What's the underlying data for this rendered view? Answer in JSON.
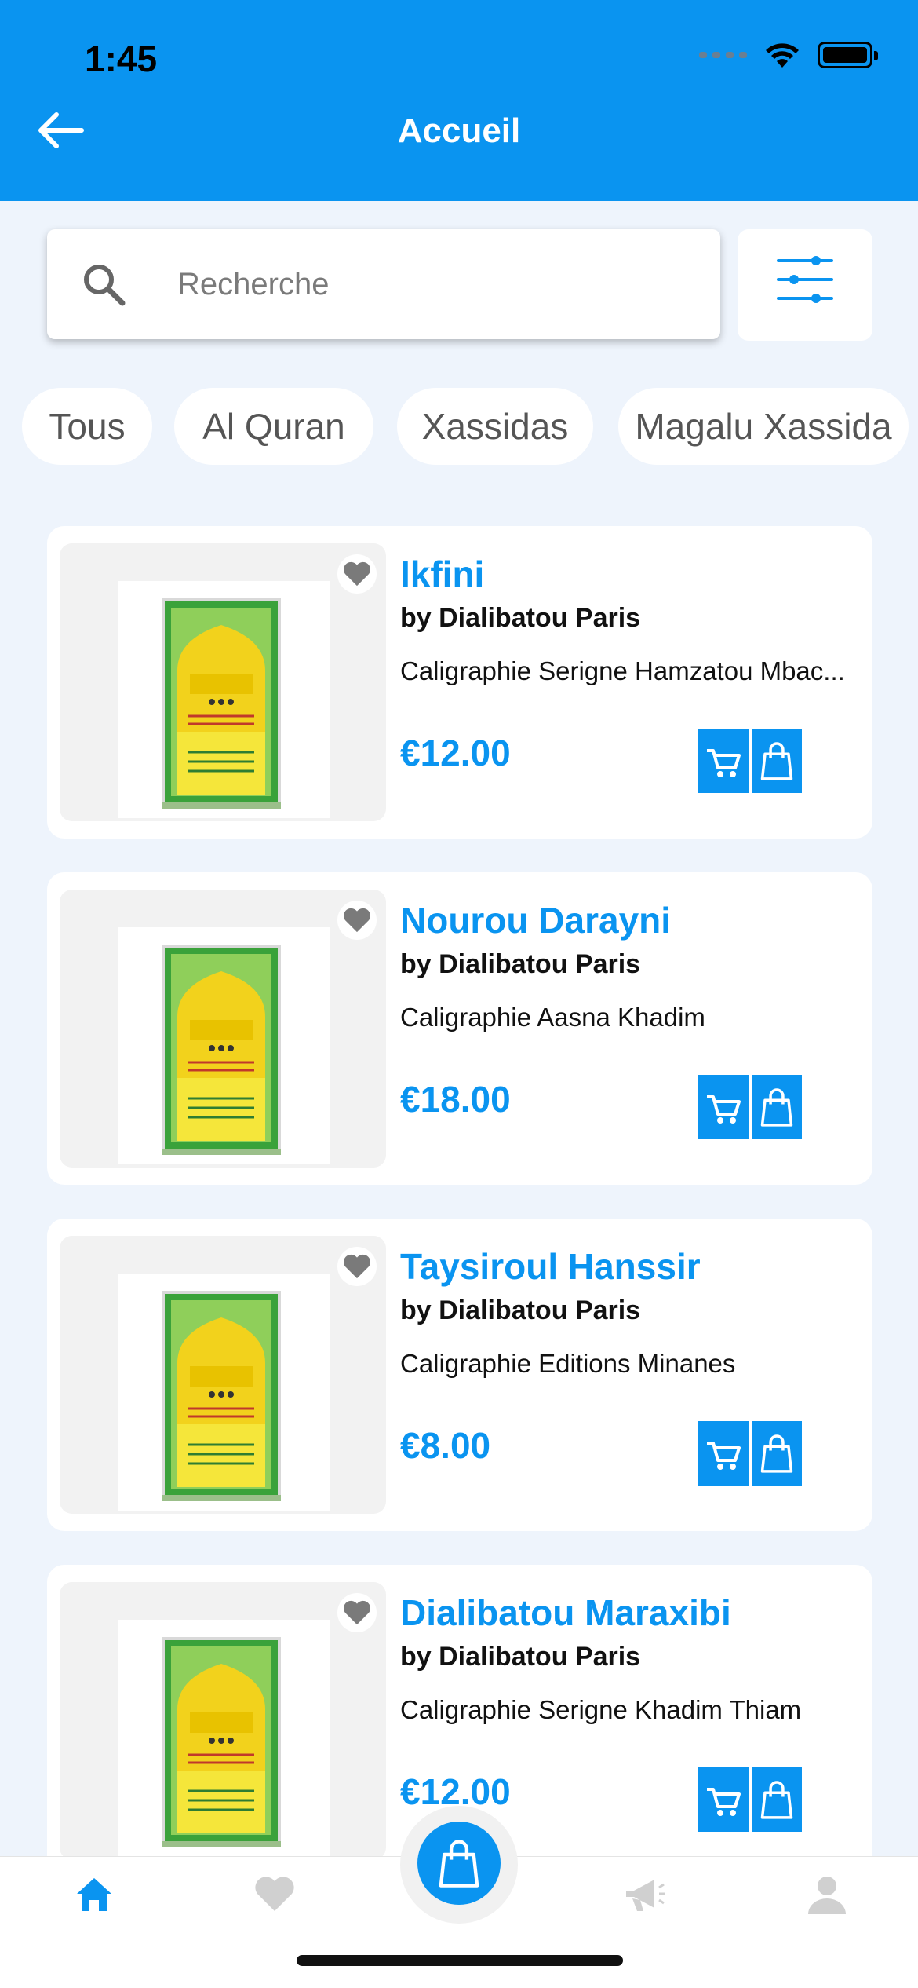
{
  "status_bar": {
    "time": "1:45"
  },
  "header": {
    "title": "Accueil"
  },
  "search": {
    "placeholder": "Recherche"
  },
  "categories": [
    "Tous",
    "Al Quran",
    "Xassidas",
    "Magalu Xassida"
  ],
  "products": [
    {
      "title": "Ikfini",
      "author": "by Dialibatou Paris",
      "description": "Caligraphie Serigne Hamzatou Mbac...",
      "price": "€12.00"
    },
    {
      "title": "Nourou Darayni",
      "author": "by Dialibatou Paris",
      "description": "Caligraphie Aasna Khadim",
      "price": "€18.00"
    },
    {
      "title": "Taysiroul Hanssir",
      "author": "by Dialibatou Paris",
      "description": "Caligraphie Editions Minanes",
      "price": "€8.00"
    },
    {
      "title": "Dialibatou Maraxibi",
      "author": "by Dialibatou Paris",
      "description": "Caligraphie Serigne Khadim Thiam",
      "price": "€12.00"
    }
  ],
  "bottom_nav": {
    "items": [
      "home-icon",
      "heart-icon",
      "shopping-bag-icon",
      "megaphone-icon",
      "user-icon"
    ],
    "active": "home-icon"
  },
  "colors": {
    "primary": "#0a94f0",
    "background": "#eef4fc",
    "inactive_icon": "#d0d0d0"
  }
}
